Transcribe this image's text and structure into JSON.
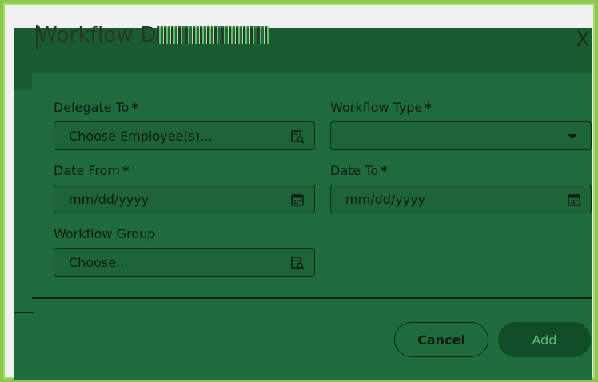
{
  "dialog": {
    "title_visible": "Workflow D",
    "close_label": "X"
  },
  "fields": {
    "delegate_to": {
      "label": "Delegate To",
      "required_mark": "*",
      "placeholder": "Choose Employee(s)..."
    },
    "workflow_type": {
      "label": "Workflow Type",
      "required_mark": "*",
      "value": ""
    },
    "date_from": {
      "label": "Date From",
      "required_mark": "*",
      "placeholder": "mm/dd/yyyy"
    },
    "date_to": {
      "label": "Date To",
      "required_mark": "*",
      "placeholder": "mm/dd/yyyy"
    },
    "workflow_group": {
      "label": "Workflow Group",
      "placeholder": "Choose..."
    }
  },
  "buttons": {
    "cancel": "Cancel",
    "add": "Add"
  },
  "colors": {
    "dialog_bg": "#1f6b3b",
    "add_button_bg": "#0f4c27",
    "frame_border": "#a5d86a"
  },
  "icons": {
    "lookup": "search-lookup-icon",
    "calendar": "calendar-icon",
    "dropdown": "chevron-down-icon",
    "close": "close-icon"
  }
}
